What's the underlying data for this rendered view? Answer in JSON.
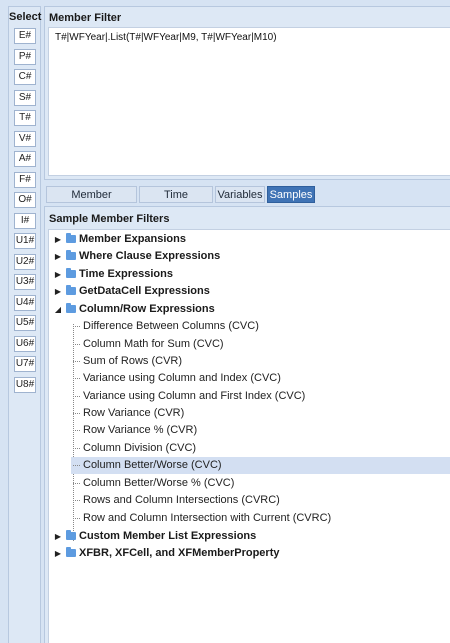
{
  "select_panel": {
    "title": "Select",
    "buttons": [
      "E#",
      "P#",
      "C#",
      "S#",
      "T#",
      "V#",
      "A#",
      "F#",
      "O#",
      "I#",
      "U1#",
      "U2#",
      "U3#",
      "U4#",
      "U5#",
      "U6#",
      "U7#",
      "U8#"
    ]
  },
  "member_filter": {
    "title": "Member Filter",
    "value": "T#|WFYear|.List(T#|WFYear|M9, T#|WFYear|M10)"
  },
  "tabs": [
    {
      "label": "Member Expansion",
      "active": false
    },
    {
      "label": "Time Functions",
      "active": false
    },
    {
      "label": "Variables",
      "active": false
    },
    {
      "label": "Samples",
      "active": true
    }
  ],
  "samples": {
    "title": "Sample Member Filters",
    "groups": [
      {
        "label": "Member Expansions",
        "expanded": false
      },
      {
        "label": "Where Clause Expressions",
        "expanded": false
      },
      {
        "label": "Time Expressions",
        "expanded": false
      },
      {
        "label": "GetDataCell Expressions",
        "expanded": false
      },
      {
        "label": "Column/Row Expressions",
        "expanded": true,
        "items": [
          "Difference Between Columns (CVC)",
          "Column Math for Sum (CVC)",
          "Sum of Rows (CVR)",
          "Variance using Column and Index (CVC)",
          "Variance using Column and First Index (CVC)",
          "Row Variance (CVR)",
          "Row Variance % (CVR)",
          "Column Division (CVC)",
          "Column Better/Worse (CVC)",
          "Column Better/Worse % (CVC)",
          "Rows and Column Intersections (CVRC)",
          "Row and Column Intersection with Current (CVRC)"
        ],
        "selected_item": "Column Better/Worse (CVC)"
      },
      {
        "label": "Custom Member List Expressions",
        "expanded": false
      },
      {
        "label": "XFBR, XFCell, and XFMemberProperty",
        "expanded": false
      }
    ]
  },
  "colors": {
    "accent": "#3f73b5",
    "folder": "#5d9be0",
    "selected_row": "#d3dff2"
  }
}
